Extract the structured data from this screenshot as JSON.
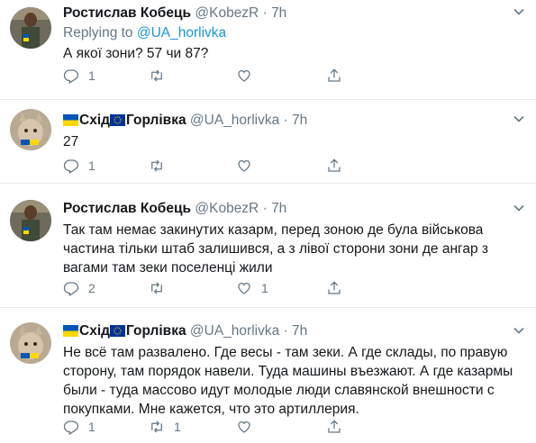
{
  "tweets": [
    {
      "name": "Ростислав Кобець",
      "handle": "@KobezR",
      "dot": "·",
      "time": "7h",
      "replying_prefix": "Replying to ",
      "replying_to": "@UA_horlivka",
      "text": "А якої зони? 57 чи 87?",
      "reply_count": "1",
      "retweet_count": "",
      "like_count": ""
    },
    {
      "name_part1": "Схід",
      "name_part2": "Горлівка",
      "handle": "@UA_horlivka",
      "dot": "·",
      "time": "7h",
      "text": "27",
      "reply_count": "1",
      "retweet_count": "",
      "like_count": ""
    },
    {
      "name": "Ростислав Кобець",
      "handle": "@KobezR",
      "dot": "·",
      "time": "7h",
      "text": "Так там немає закинутих казарм, перед зоною де була військова частина тільки штаб залишився, а з лівої сторони зони де ангар з вагами там зеки поселенці жили",
      "reply_count": "2",
      "retweet_count": "",
      "like_count": "1"
    },
    {
      "name_part1": "Схід",
      "name_part2": "Горлівка",
      "handle": "@UA_horlivka",
      "dot": "·",
      "time": "7h",
      "text": "Не всё там развалено. Где весы - там зеки. А где склады, по правую сторону, там порядок навели. Туда машины въезжают. А где казармы были - туда массово идут молодые люди славянской внешности с покупками. Мне кажется, что это артиллерия.",
      "reply_count": "1",
      "retweet_count": "1",
      "like_count": ""
    }
  ],
  "icons": {
    "reply": "reply-icon",
    "retweet": "retweet-icon",
    "like": "heart-icon",
    "share": "share-icon",
    "more": "chevron-down-icon"
  },
  "colors": {
    "text": "#14171a",
    "secondary": "#657786",
    "link": "#1b95e0",
    "divider": "#e6ecf0",
    "ua_blue": "#0057b7",
    "ua_yellow": "#ffd700",
    "eu_blue": "#003399",
    "eu_star": "#ffcc00"
  }
}
